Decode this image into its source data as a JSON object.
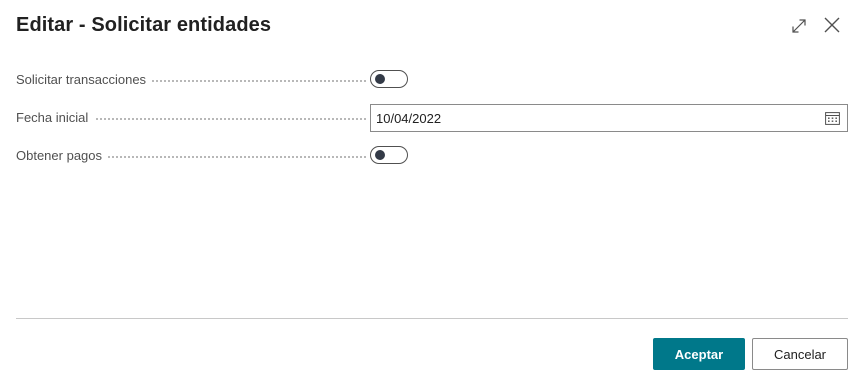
{
  "dialog": {
    "title": "Editar - Solicitar entidades",
    "expand_icon": "expand-icon",
    "close_icon": "close-icon"
  },
  "fields": {
    "solicitar_transacciones": {
      "label": "Solicitar transacciones",
      "toggled": false
    },
    "fecha_inicial": {
      "label": "Fecha inicial",
      "value": "10/04/2022",
      "icon": "calendar-icon"
    },
    "obtener_pagos": {
      "label": "Obtener pagos",
      "toggled": false
    }
  },
  "footer": {
    "accept_label": "Aceptar",
    "cancel_label": "Cancelar"
  },
  "colors": {
    "primary_button": "#00788a",
    "toggle_knob": "#333a47",
    "text": "#212121",
    "label": "#505050"
  }
}
